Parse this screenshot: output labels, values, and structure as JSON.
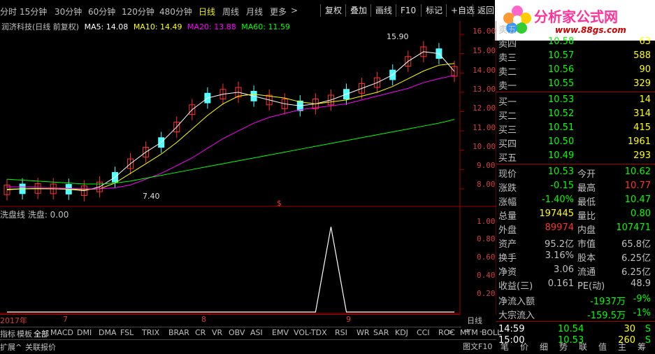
{
  "toolbar": {
    "periods": [
      "分时",
      "15分钟",
      "30分钟",
      "60分钟",
      "120分钟",
      "480分钟",
      "日线",
      "周线",
      "月线",
      "更多"
    ],
    "active_period": "日线",
    "more_arrow": ">",
    "buttons": [
      "复权",
      "叠加",
      "画线",
      "F10",
      "标记",
      "+自选",
      "返回"
    ]
  },
  "logo": {
    "text": "分析家公式网",
    "url": "www.88gs.com"
  },
  "chart": {
    "legend": {
      "stock": "润济科技(日线 前复权)",
      "ma5": "MA5: 14.08",
      "ma10": "MA10: 14.49",
      "ma20": "MA20: 13.88",
      "ma60": "MA60: 11.59"
    },
    "high_label": "15.90",
    "low_label": "7.40",
    "marker_symbol": "$",
    "price_ticks": [
      "16.00",
      "15.00",
      "14.00",
      "13.00",
      "12.00",
      "11.00",
      "10.00",
      "9.00",
      "8.00"
    ],
    "sub_legend": "洗盘线 洗盘: 0.00",
    "sub_ticks": [
      "1.00",
      "0.80",
      "0.60",
      "0.40",
      "0.20"
    ],
    "date_labels": [
      "2017年",
      "7",
      "8",
      "9"
    ],
    "colors": {
      "up": "#ff3232",
      "down": "#54ffff",
      "ma5": "#ffffff",
      "ma10": "#ffff00",
      "ma20": "#ff00ff",
      "ma60": "#00ff00"
    }
  },
  "chart_data": [
    {
      "type": "line",
      "title": "润济科技(日线 前复权)",
      "series": [
        {
          "name": "MA5",
          "values": [
            7.95,
            8.0,
            8.02,
            8.0,
            7.98,
            7.9,
            8.1,
            8.6,
            9.3,
            9.9,
            10.4,
            11.2,
            12.1,
            12.7,
            12.9,
            13.0,
            12.8,
            12.6,
            12.4,
            12.3,
            12.4,
            12.6,
            12.9,
            13.2,
            13.5,
            13.9,
            14.6,
            15.1,
            15.0,
            14.08
          ]
        },
        {
          "name": "MA10",
          "values": [
            7.98,
            8.0,
            8.0,
            8.0,
            7.99,
            7.96,
            8.0,
            8.3,
            8.8,
            9.3,
            9.8,
            10.4,
            11.1,
            11.8,
            12.4,
            12.8,
            12.9,
            12.8,
            12.7,
            12.5,
            12.4,
            12.5,
            12.6,
            12.8,
            13.0,
            13.3,
            13.7,
            14.1,
            14.4,
            14.49
          ]
        },
        {
          "name": "MA20",
          "values": [
            8.1,
            8.1,
            8.08,
            8.05,
            8.02,
            8.0,
            8.0,
            8.05,
            8.2,
            8.5,
            8.8,
            9.2,
            9.6,
            10.1,
            10.6,
            11.0,
            11.4,
            11.7,
            11.9,
            12.1,
            12.2,
            12.3,
            12.4,
            12.6,
            12.8,
            13.0,
            13.2,
            13.5,
            13.7,
            13.88
          ]
        },
        {
          "name": "MA60",
          "values": [
            8.5,
            8.45,
            8.4,
            8.35,
            8.3,
            8.25,
            8.25,
            8.3,
            8.4,
            8.55,
            8.7,
            8.85,
            9.0,
            9.15,
            9.3,
            9.45,
            9.6,
            9.75,
            9.9,
            10.05,
            10.2,
            10.35,
            10.5,
            10.65,
            10.8,
            10.95,
            11.1,
            11.25,
            11.4,
            11.59
          ]
        }
      ],
      "ylim": [
        7.2,
        16.4
      ]
    },
    {
      "type": "line",
      "title": "洗盘线",
      "series": [
        {
          "name": "洗盘",
          "values": [
            0,
            0,
            0,
            0,
            0,
            0,
            0,
            0,
            0,
            0,
            0,
            0,
            0,
            0,
            0,
            0,
            0,
            0,
            0,
            0,
            0,
            1,
            0,
            0,
            0,
            0,
            0,
            0,
            0,
            0
          ]
        }
      ],
      "ylim": [
        0,
        1.1
      ]
    }
  ],
  "sub_tabs": [
    "指标",
    "模板",
    "全部",
    "MACD",
    "DMI",
    "DMA",
    "FSL",
    "TRIX",
    "BRAR",
    "CR",
    "VR",
    "OBV",
    "ASI",
    "EMV",
    "VOL-TDX",
    "RSI",
    "WR",
    "SAR",
    "KDJ",
    "CCI",
    "ROC",
    "MTM",
    "BOLL"
  ],
  "bottom": {
    "expand": "扩展^",
    "related": "关联报价",
    "scroll_arrow": ">"
  },
  "quote": {
    "sells": [
      {
        "label": "卖五",
        "price": "",
        "vol": ""
      },
      {
        "label": "卖四",
        "price": "10.58",
        "vol": "63"
      },
      {
        "label": "卖三",
        "price": "10.57",
        "vol": "588"
      },
      {
        "label": "卖二",
        "price": "10.56",
        "vol": "90"
      },
      {
        "label": "卖一",
        "price": "10.55",
        "vol": "329"
      }
    ],
    "buys": [
      {
        "label": "买一",
        "price": "10.53",
        "vol": "14"
      },
      {
        "label": "买二",
        "price": "10.52",
        "vol": "314"
      },
      {
        "label": "买三",
        "price": "10.51",
        "vol": "415"
      },
      {
        "label": "买四",
        "price": "10.50",
        "vol": "1961"
      },
      {
        "label": "买五",
        "price": "10.49",
        "vol": "293"
      }
    ],
    "stats": [
      {
        "l1": "现价",
        "v1": "10.53",
        "l2": "今开",
        "v2": "10.62",
        "c1": "#00ff00",
        "c2": "#00ff00"
      },
      {
        "l1": "涨跌",
        "v1": "-0.15",
        "l2": "最高",
        "v2": "10.77",
        "c1": "#00ff00",
        "c2": "#ff3232"
      },
      {
        "l1": "涨幅",
        "v1": "-1.40%",
        "l2": "最低",
        "v2": "10.47",
        "c1": "#00ff00",
        "c2": "#00ff00"
      },
      {
        "l1": "总量",
        "v1": "197445",
        "l2": "量比",
        "v2": "0.80",
        "c1": "#ffff00",
        "c2": "#00ff00"
      },
      {
        "l1": "外盘",
        "v1": "89974",
        "l2": "内盘",
        "v2": "107471",
        "c1": "#ff3232",
        "c2": "#00ff00"
      },
      {
        "l1": "资产",
        "v1": "95.2亿",
        "l2": "市值",
        "v2": "65.8亿",
        "c1": "#c0c0c0",
        "c2": "#c0c0c0"
      },
      {
        "l1": "换手",
        "v1": "3.16%",
        "l2": "股本",
        "v2": "6.25亿",
        "c1": "#c0c0c0",
        "c2": "#c0c0c0"
      },
      {
        "l1": "净资",
        "v1": "3.06",
        "l2": "流通",
        "v2": "6.25亿",
        "c1": "#c0c0c0",
        "c2": "#c0c0c0"
      },
      {
        "l1": "收益(三)",
        "v1": "0.161",
        "l2": "PE(动)",
        "v2": "48.9",
        "c1": "#c0c0c0",
        "c2": "#c0c0c0"
      }
    ],
    "flows": [
      {
        "label": "净流入额",
        "value": "-1937万",
        "pct": "-9%"
      },
      {
        "label": "大宗流入",
        "value": "-159.5万",
        "pct": "-1%"
      }
    ],
    "ticks": [
      {
        "time": "14:59",
        "price": "10.54",
        "vol": "30",
        "flag": "S"
      },
      {
        "time": "15:00",
        "price": "10.53",
        "vol": "260",
        "flag": "S"
      }
    ],
    "period_tag": "日线",
    "plus": "+",
    "minus": "-",
    "f10_label": "图文F10",
    "bottom_tabs": [
      "笔",
      "价",
      "细",
      "势",
      "联",
      "值",
      "主",
      "筹"
    ]
  }
}
